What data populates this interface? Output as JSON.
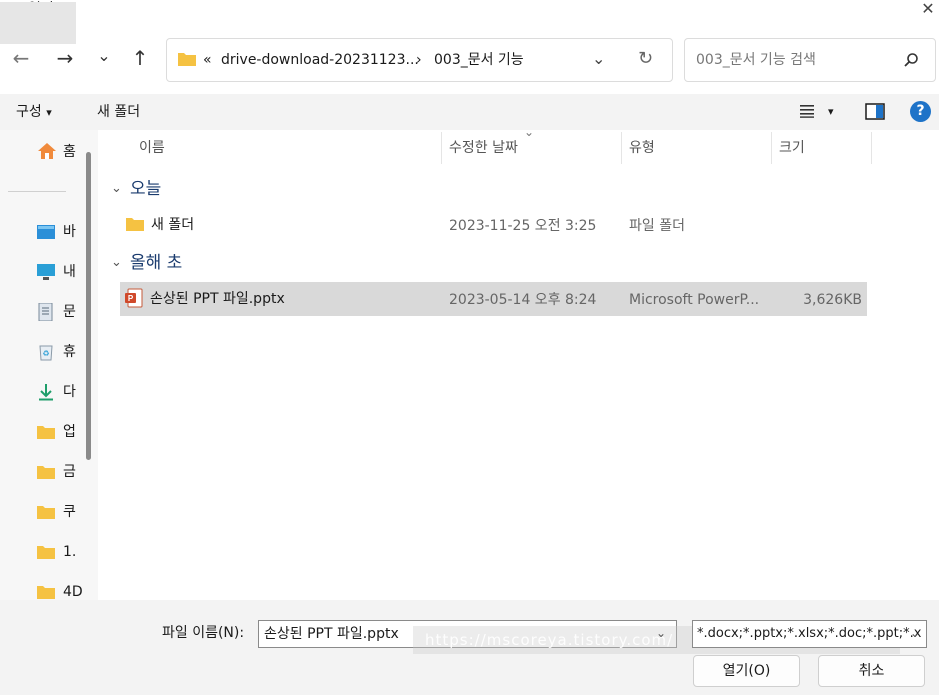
{
  "window": {
    "title": "열기",
    "close_glyph": "✕"
  },
  "nav": {
    "back_glyph": "←",
    "forward_glyph": "→",
    "recent_glyph": "⌄",
    "up_glyph": "↑"
  },
  "address": {
    "overflow_glyph": "«",
    "crumbs": [
      "drive-download-20231123...",
      "003_문서 기능"
    ],
    "separator": "›",
    "dropdown_glyph": "⌄",
    "refresh_glyph": "↻"
  },
  "search": {
    "placeholder": "003_문서 기능 검색",
    "icon": "search-icon"
  },
  "commands": {
    "organize": "구성",
    "organize_caret": "▾",
    "new_folder": "새 폴더",
    "view_caret": "▾",
    "help_glyph": "?"
  },
  "sidebar": {
    "home": "홈",
    "items": [
      {
        "label": "바",
        "icon": "desktop-icon"
      },
      {
        "label": "내",
        "icon": "pc-icon"
      },
      {
        "label": "문",
        "icon": "documents-icon"
      },
      {
        "label": "휴",
        "icon": "recycle-bin-icon"
      },
      {
        "label": "다",
        "icon": "download-icon"
      },
      {
        "label": "업",
        "icon": "folder-icon"
      },
      {
        "label": "금",
        "icon": "folder-icon"
      },
      {
        "label": "쿠",
        "icon": "folder-icon"
      },
      {
        "label": "1.",
        "icon": "folder-icon"
      },
      {
        "label": "4D",
        "icon": "folder-icon"
      }
    ]
  },
  "columns": {
    "name": "이름",
    "modified": "수정한 날짜",
    "type": "유형",
    "size": "크기",
    "sort_glyph": "⌄"
  },
  "groups": [
    {
      "label": "오늘",
      "chevron": "⌄",
      "files": [
        {
          "name": "새 폴더",
          "modified": "2023-11-25 오전 3:25",
          "type": "파일 폴더",
          "size": "",
          "icon": "folder-icon"
        }
      ]
    },
    {
      "label": "올해 초",
      "chevron": "⌄",
      "files": [
        {
          "name": "손상된 PPT 파일.pptx",
          "modified": "2023-05-14 오후 8:24",
          "type": "Microsoft PowerP...",
          "size": "3,626KB",
          "icon": "powerpoint-icon"
        }
      ]
    }
  ],
  "footer": {
    "filename_label": "파일 이름(N):",
    "filename_value": "손상된 PPT 파일.pptx",
    "filetype_value": "*.docx;*.pptx;*.xlsx;*.doc;*.ppt;*.x",
    "dropdown_glyph": "⌄",
    "watermark": "https://mscoreya.tistory.com/",
    "open_label": "열기(O)",
    "cancel_label": "취소"
  },
  "colors": {
    "accent": "#0067c0",
    "folder": "#f5c242",
    "selection": "#d9d9d9",
    "group_text": "#1a3b6e"
  }
}
